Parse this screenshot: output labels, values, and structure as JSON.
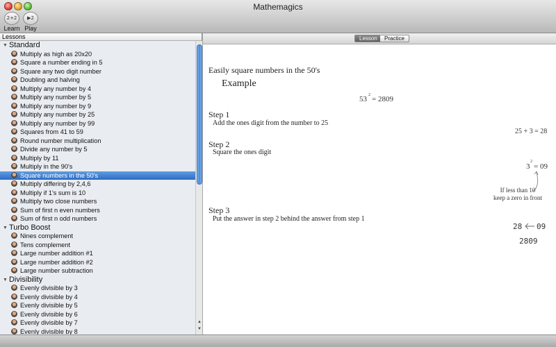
{
  "window": {
    "title": "Mathemagics"
  },
  "toolbar": {
    "learn": {
      "label": "Learn",
      "icon_text": "2+2"
    },
    "play": {
      "label": "Play",
      "icon_text": "▶2"
    }
  },
  "sidebar": {
    "header": "Lessons",
    "groups": [
      {
        "name": "Standard",
        "items": [
          "Multiply as high as 20x20",
          "Square a number ending in 5",
          "Square any two digit number",
          "Doubling and halving",
          "Multiply any number by 4",
          "Multiply any number by 5",
          "Multiply any number by 9",
          "Multiply any number by 25",
          "Multiply any number by 99",
          "Squares from 41 to 59",
          "Round number multiplication",
          "Divide any number by 5",
          "Multiply by 11",
          "Multiply in the 90's",
          "Square numbers in the 50's",
          "Multiply differing by 2,4,6",
          "Multiply if 1's sum is 10",
          "Multiply two close numbers",
          "Sum of first n even numbers",
          "Sum of first n odd numbers"
        ]
      },
      {
        "name": "Turbo Boost",
        "items": [
          "Nines complement",
          "Tens complement",
          "Large number addition #1",
          "Large number addition #2",
          "Large number subtraction"
        ]
      },
      {
        "name": "Divisibility",
        "items": [
          "Evenly divisible by 3",
          "Evenly divisible by 4",
          "Evenly divisible by 5",
          "Evenly divisible by 6",
          "Evenly divisible by 7",
          "Evenly divisible by 8"
        ]
      }
    ],
    "selected": "Square numbers in the 50's"
  },
  "tabs": {
    "lesson": "Lesson",
    "practice": "Practice",
    "active": "Lesson"
  },
  "lesson": {
    "title": "Easily square numbers in the 50's",
    "example_label": "Example",
    "example": {
      "base": "53",
      "exponent": "2",
      "result": "= 2809"
    },
    "steps": [
      {
        "title": "Step 1",
        "desc": "Add the ones digit from the number to 25",
        "math": "25 + 3 = 28"
      },
      {
        "title": "Step 2",
        "desc": "Square the ones digit",
        "math_base": "3",
        "math_exp": "2",
        "math_result": "= 09"
      },
      {
        "title": "Step 3",
        "desc": "Put the answer in step 2 behind the answer from step 1"
      }
    ],
    "note_line1": "If less than 10",
    "note_line2": "keep a zero in front",
    "final_left": "28",
    "final_right": "09",
    "final_answer": "2809"
  }
}
